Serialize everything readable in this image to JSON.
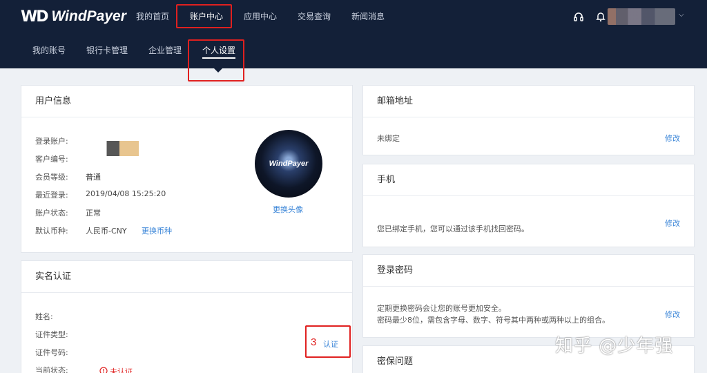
{
  "topbar": {
    "logo_mark": "WD",
    "logo_text": "WindPayer",
    "nav": [
      "我的首页",
      "账户中心",
      "应用中心",
      "交易查询",
      "新闻消息"
    ],
    "icons": [
      "headset-icon",
      "bell-icon",
      "chevron-down-icon"
    ]
  },
  "subnav": [
    "我的账号",
    "银行卡管理",
    "企业管理",
    "个人设置"
  ],
  "user_info": {
    "title": "用户信息",
    "rows": [
      {
        "label": "登录账户:",
        "value": ""
      },
      {
        "label": "客户编号:",
        "value": ""
      },
      {
        "label": "会员等级:",
        "value": "普通"
      },
      {
        "label": "最近登录:",
        "value": "2019/04/08 15:25:20"
      },
      {
        "label": "账户状态:",
        "value": "正常"
      },
      {
        "label": "默认币种:",
        "value": "人民币-CNY"
      }
    ],
    "change_currency": "更换币种",
    "avatar_text": "WindPayer",
    "change_avatar": "更换头像"
  },
  "realname": {
    "title": "实名认证",
    "rows": [
      "姓名:",
      "证件类型:",
      "证件号码:",
      "当前状态:"
    ],
    "status": "未认证",
    "auth_link": "认证",
    "annotation_number": "3"
  },
  "email": {
    "title": "邮箱地址",
    "text": "未绑定",
    "action": "修改"
  },
  "phone": {
    "title": "手机",
    "text": "您已绑定手机，您可以通过该手机找回密码。",
    "action": "修改"
  },
  "password": {
    "title": "登录密码",
    "line1": "定期更换密码会让您的账号更加安全。",
    "line2": "密码最少8位，需包含字母、数字、符号其中两种或两种以上的组合。",
    "action": "修改"
  },
  "security_q": {
    "title": "密保问题"
  },
  "watermark": "知乎 @少年强"
}
